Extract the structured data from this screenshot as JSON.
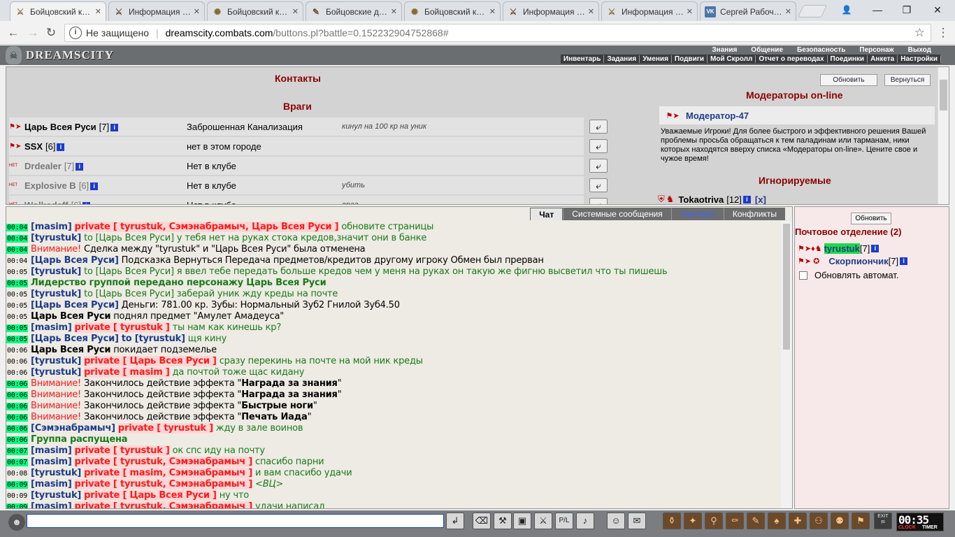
{
  "browser": {
    "tabs": [
      {
        "icon": "crossed-swords-icon",
        "glyph": "⚔",
        "label": "Бойцовский к…"
      },
      {
        "icon": "crossed-swords-icon",
        "glyph": "⚔",
        "label": "Информация …"
      },
      {
        "icon": "warrior-icon",
        "glyph": "✺",
        "label": "Бойцовский к…"
      },
      {
        "icon": "scroll-icon",
        "glyph": "✎",
        "label": "Бойцовские д…"
      },
      {
        "icon": "warrior-icon",
        "glyph": "✺",
        "label": "Бойцовский к…"
      },
      {
        "icon": "crossed-swords-icon",
        "glyph": "⚔",
        "label": "Информация …"
      },
      {
        "icon": "crossed-swords-icon",
        "glyph": "⚔",
        "label": "Информация …"
      },
      {
        "icon": "vk-icon",
        "glyph": "VK",
        "label": "Сергей Рабоч…"
      }
    ],
    "close_glyph": "✕",
    "address": {
      "not_secure": "Не защищено",
      "host": "dreamscity.combats.com",
      "path": "/buttons.pl?battle=0.152232904752868#"
    }
  },
  "game": {
    "logo": "DREAMSCITY",
    "menu_top": [
      "Знания",
      "Общение",
      "Безопасность",
      "Персонаж",
      "Выход"
    ],
    "menu_bottom": [
      "Инвентарь",
      "Задания",
      "Умения",
      "Подвиги",
      "Мой Скролл",
      "Отчет о переводах",
      "Поединки",
      "Анкета",
      "Настройки"
    ]
  },
  "contacts": {
    "title": "Контакты",
    "refresh": "Обновить",
    "back": "Вернуться",
    "enemies_title": "Враги",
    "enemies": [
      {
        "name": "Царь Всея Руси",
        "level": "[7]",
        "icon": "👑",
        "location": "Заброшенная Канализация",
        "comment": "кинул на 100 кр на уник",
        "online": true
      },
      {
        "name": "SSX",
        "level": "[6]",
        "icon": "🛡",
        "location": "нет в этом городе",
        "comment": "",
        "online": true
      },
      {
        "name": "Drdealer",
        "level": "[7]",
        "icon": "НЕТ",
        "location": "Нет в клубе",
        "comment": "",
        "online": false
      },
      {
        "name": "Explosive B",
        "level": "[6]",
        "icon": "НЕТ",
        "location": "Нет в клубе",
        "comment": "убить",
        "online": false
      },
      {
        "name": "Wolkodaff",
        "level": "[6]",
        "icon": "НЕТ",
        "location": "Нет в клубе",
        "comment": "враг",
        "online": false
      }
    ],
    "moderators_title": "Модераторы on-line",
    "moderator": "Модератор-47",
    "moderator_text": "Уважаемые Игроки! Для более быстрого и эффективного решения Вашей проблемы просьба обращаться к тем паладинам или тарманам, ники которых находятся вверху списка «Модераторы on-line». Цените свое и чужое время!",
    "ignored_title": "Игнорируемые",
    "ignored": {
      "name": "Tokaotriva",
      "level": "[12]",
      "remove": "[x]"
    }
  },
  "chat": {
    "tabs": [
      "Чат",
      "Системные сообщения",
      "Торговля",
      "Конфликты"
    ],
    "messages": [
      {
        "time": "00:04",
        "hl": true,
        "parts": [
          [
            "au",
            "[masim]"
          ],
          [
            "",
            " "
          ],
          [
            "pv",
            "private [ tyrustuk, Сэмэнабрамыч, Царь Всея Руси ]"
          ],
          [
            "grn",
            " обновите страницы"
          ]
        ]
      },
      {
        "time": "00:04",
        "hl": true,
        "parts": [
          [
            "au",
            "[tyrustuk]"
          ],
          [
            "grn",
            " to [Царь Всея Руси] у тебя нет на руках стока кредов,значит они в банке"
          ]
        ]
      },
      {
        "time": "00:04",
        "hl": true,
        "parts": [
          [
            "red",
            "Внимание!"
          ],
          [
            "",
            " Сделка между \"tyrustuk\" и \"Царь Всея Руси\" была отменена"
          ]
        ]
      },
      {
        "time": "00:04",
        "hl": false,
        "parts": [
          [
            "au",
            "[Царь Всея Руси]"
          ],
          [
            "",
            " Подсказка Вернуться Передача предметов/кредитов другому игроку Обмен был прерван"
          ]
        ]
      },
      {
        "time": "00:05",
        "hl": false,
        "parts": [
          [
            "au",
            "[tyrustuk]"
          ],
          [
            "grn",
            " to [Царь Всея Руси] я ввел тебе передать больше кредов чем у меня на руках он такую же фигню высветил что ты пишешь"
          ]
        ]
      },
      {
        "time": "00:05",
        "hl": true,
        "parts": [
          [
            "grn bold",
            "Лидерство группой передано персонажу Царь Всея Руси"
          ]
        ]
      },
      {
        "time": "00:05",
        "hl": false,
        "parts": [
          [
            "au",
            "[tyrustuk]"
          ],
          [
            "grn",
            " to [Царь Всея Руси] заберай уник жду креды на почте"
          ]
        ]
      },
      {
        "time": "00:05",
        "hl": false,
        "parts": [
          [
            "au",
            "[Царь Всея Руси]"
          ],
          [
            "",
            " Деньги: 781.00 кр. Зубы: Нормальный Зуб2 Гнилой Зуб4.50"
          ]
        ]
      },
      {
        "time": "00:05",
        "hl": false,
        "parts": [
          [
            "bold",
            "Царь Всея Руси"
          ],
          [
            "",
            " поднял предмет \"Амулет Амадеуса\""
          ]
        ]
      },
      {
        "time": "00:05",
        "hl": true,
        "parts": [
          [
            "au",
            "[masim]"
          ],
          [
            "",
            " "
          ],
          [
            "pv",
            "private [ tyrustuk ]"
          ],
          [
            "grn",
            " ты нам как кинешь кр?"
          ]
        ]
      },
      {
        "time": "00:05",
        "hl": true,
        "parts": [
          [
            "au",
            "[Царь Всея Руси]"
          ],
          [
            "",
            " "
          ],
          [
            "au",
            "to [tyrustuk]"
          ],
          [
            "grn",
            " щя кину"
          ]
        ]
      },
      {
        "time": "00:06",
        "hl": false,
        "parts": [
          [
            "bold",
            "Царь Всея Руси"
          ],
          [
            "",
            " покидает подземелье"
          ]
        ]
      },
      {
        "time": "00:06",
        "hl": false,
        "parts": [
          [
            "au",
            "[tyrustuk]"
          ],
          [
            "",
            " "
          ],
          [
            "pv",
            "private [ Царь Всея Руси ]"
          ],
          [
            "grn",
            " сразу перекинь на почте на мой ник креды"
          ]
        ]
      },
      {
        "time": "00:06",
        "hl": false,
        "parts": [
          [
            "au",
            "[tyrustuk]"
          ],
          [
            "",
            " "
          ],
          [
            "pv",
            "private [ masim ]"
          ],
          [
            "grn",
            " да почтой тоже щас кидану"
          ]
        ]
      },
      {
        "time": "00:06",
        "hl": true,
        "parts": [
          [
            "red",
            "Внимание!"
          ],
          [
            "",
            " Закончилось действие эффекта \""
          ],
          [
            "bold",
            "Награда за знания"
          ],
          [
            "",
            "\""
          ]
        ]
      },
      {
        "time": "00:06",
        "hl": true,
        "parts": [
          [
            "red",
            "Внимание!"
          ],
          [
            "",
            " Закончилось действие эффекта \""
          ],
          [
            "bold",
            "Награда за знания"
          ],
          [
            "",
            "\""
          ]
        ]
      },
      {
        "time": "00:06",
        "hl": true,
        "parts": [
          [
            "red",
            "Внимание!"
          ],
          [
            "",
            " Закончилось действие эффекта \""
          ],
          [
            "bold",
            "Быстрые ноги"
          ],
          [
            "",
            "\""
          ]
        ]
      },
      {
        "time": "00:06",
        "hl": true,
        "parts": [
          [
            "red",
            "Внимание!"
          ],
          [
            "",
            " Закончилось действие эффекта \""
          ],
          [
            "bold",
            "Печать Иада"
          ],
          [
            "",
            "\""
          ]
        ]
      },
      {
        "time": "00:06",
        "hl": true,
        "parts": [
          [
            "au",
            "[Сэмэнабрамыч]"
          ],
          [
            "",
            " "
          ],
          [
            "pv",
            "private [ tyrustuk ]"
          ],
          [
            "grn",
            " жду в зале воинов"
          ]
        ]
      },
      {
        "time": "00:06",
        "hl": true,
        "parts": [
          [
            "grn bold",
            "Группа распущена"
          ]
        ]
      },
      {
        "time": "00:07",
        "hl": true,
        "parts": [
          [
            "au",
            "[masim]"
          ],
          [
            "",
            " "
          ],
          [
            "pv",
            "private [ tyrustuk ]"
          ],
          [
            "grn",
            " ок спс иду на почту"
          ]
        ]
      },
      {
        "time": "00:07",
        "hl": true,
        "parts": [
          [
            "au",
            "[masim]"
          ],
          [
            "",
            " "
          ],
          [
            "pv",
            "private [ tyrustuk, Сэмэнабрамыч ]"
          ],
          [
            "grn",
            " спасибо парни"
          ]
        ]
      },
      {
        "time": "00:08",
        "hl": false,
        "parts": [
          [
            "au",
            "[tyrustuk]"
          ],
          [
            "",
            " "
          ],
          [
            "pv",
            "private [ masim, Сэмэнабрамыч ]"
          ],
          [
            "grn",
            " и вам спасибо удачи"
          ]
        ]
      },
      {
        "time": "00:09",
        "hl": true,
        "parts": [
          [
            "au",
            "[masim]"
          ],
          [
            "",
            " "
          ],
          [
            "pv",
            "private [ tyrustuk, Сэмэнабрамыч ]"
          ],
          [
            "grn ital",
            " <ВЦ>"
          ]
        ]
      },
      {
        "time": "00:09",
        "hl": false,
        "parts": [
          [
            "au",
            "[tyrustuk]"
          ],
          [
            "",
            " "
          ],
          [
            "pv",
            "private [ Царь Всея Руси ]"
          ],
          [
            "grn",
            " ну что"
          ]
        ]
      },
      {
        "time": "00:09",
        "hl": true,
        "parts": [
          [
            "au",
            "[masim]"
          ],
          [
            "",
            " "
          ],
          [
            "pv",
            "private [ tyrustuk, Сэмэнабрамыч ]"
          ],
          [
            "grn",
            " удачи написал"
          ]
        ]
      }
    ]
  },
  "mail": {
    "refresh": "Обновить",
    "title": "Почтовое отделение (2)",
    "users": [
      {
        "name": "tyrustuk",
        "level": "[7]",
        "highlight": true
      },
      {
        "name": "Скорпиончик",
        "level": "[7]",
        "highlight": false
      }
    ],
    "auto_refresh": "Обновлять автомат."
  },
  "bottom": {
    "clock_time": "00:35",
    "clock_label": "CLOCK",
    "timer_label": "TIMER",
    "exit_label": "EXIT"
  },
  "colors": {
    "highlight_time": "#00ff80",
    "private": "#ff1a1a",
    "author": "#1d3c8a",
    "accent": "#8b0000"
  }
}
